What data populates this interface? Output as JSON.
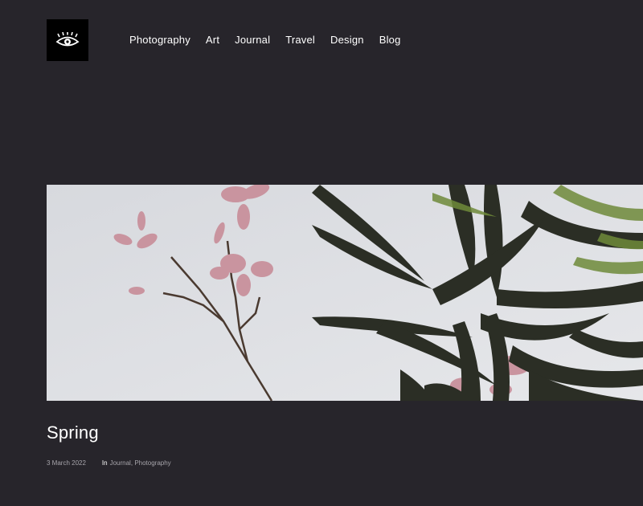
{
  "site": {
    "logo_icon": "eye-icon",
    "colors": {
      "background": "#27252b",
      "logo_bg": "#000000",
      "text": "#ffffff",
      "meta": "#a6a4aa"
    }
  },
  "nav": {
    "items": [
      {
        "label": "Photography"
      },
      {
        "label": "Art"
      },
      {
        "label": "Journal"
      },
      {
        "label": "Travel"
      },
      {
        "label": "Design"
      },
      {
        "label": "Blog"
      }
    ]
  },
  "post": {
    "title": "Spring",
    "date": "3 March 2022",
    "in_label": "In",
    "categories": [
      "Journal",
      "Photography"
    ],
    "category_separator": ","
  }
}
